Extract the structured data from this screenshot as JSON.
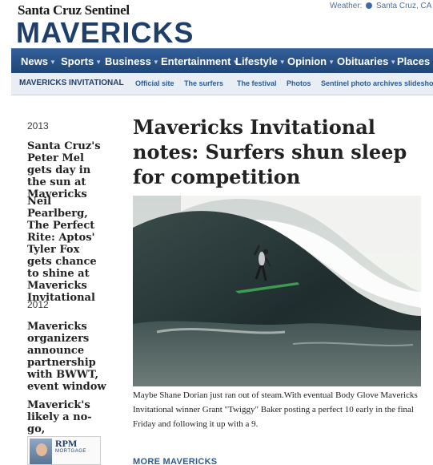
{
  "masthead": {
    "paper_name": "Santa Cruz Sentinel",
    "section_title": "MAVERICKS",
    "weather_label": "Weather:",
    "weather_location": "Santa Cruz, CA"
  },
  "nav": {
    "items": [
      "News",
      "Sports",
      "Business",
      "Entertainment",
      "Lifestyle",
      "Opinion",
      "Obituaries",
      "Places"
    ]
  },
  "subnav": {
    "main": "MAVERICKS INVITATIONAL",
    "items": [
      "Official site",
      "The surfers",
      "The festival",
      "Photos",
      "Sentinel photo archives slideshow"
    ]
  },
  "sidebar": {
    "year_2013": "2013",
    "year_2012": "2012",
    "links": [
      "Santa Cruz's Peter Mel gets day in the sun at Mavericks",
      "Neil Pearlberg, The Perfect Rite: Aptos' Tyler Fox gets chance to shine at Mavericks Invitational",
      "Mavericks organizers announce partnership with BWWT, event window",
      "Maverick's likely a no-go, organizers say"
    ],
    "ad": {
      "brand": "RPM",
      "tagline": "MORTGAGE"
    }
  },
  "article": {
    "headline": "Mavericks Invitational notes: Surfers shun sleep for competition",
    "caption": "Maybe Shane Dorian just ran out of steam.With eventual Body Glove Mavericks Invitational winner Grant \"Twiggy\" Baker posting a perfect 10 early in the final Friday and following it up with a 9."
  },
  "more_link": "MORE MAVERICKS",
  "colors": {
    "brand_blue": "#1f3f6b",
    "nav_blue": "#2a5489",
    "link_blue": "#2d5b94"
  }
}
